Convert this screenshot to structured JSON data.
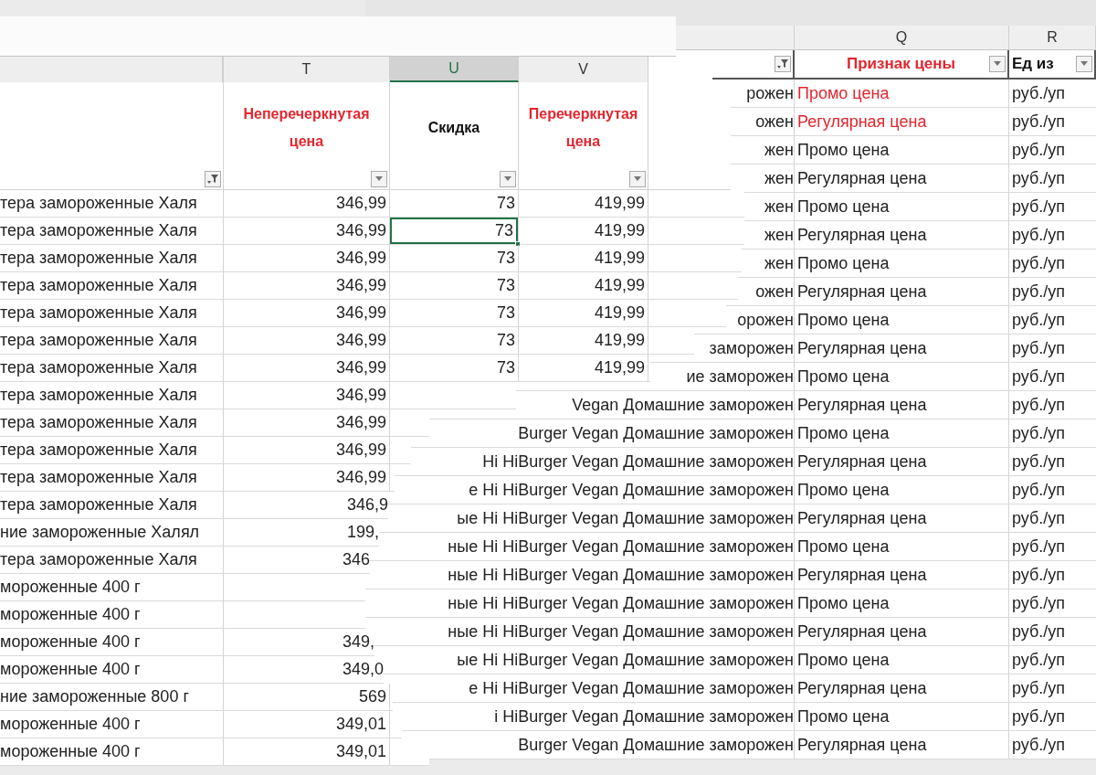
{
  "left_sheet": {
    "first_column": {
      "filter_active": true
    },
    "columns": [
      {
        "letter": "T",
        "selected": false,
        "header": "Неперечеркнутая цена",
        "header_red": true,
        "filter_active": false
      },
      {
        "letter": "U",
        "selected": true,
        "header": "Скидка",
        "header_red": false,
        "filter_active": false
      },
      {
        "letter": "V",
        "selected": false,
        "header": "Перечеркнутая цена",
        "header_red": true,
        "filter_active": false
      }
    ],
    "rows": [
      {
        "name": "тера замороженные Халя",
        "cells": [
          {
            "text": "346,99",
            "selected": false
          },
          {
            "text": "73",
            "selected": false
          },
          {
            "text": "419,99",
            "selected": false
          }
        ]
      },
      {
        "name": "тера замороженные Халя",
        "cells": [
          {
            "text": "346,99",
            "selected": false
          },
          {
            "text": "73",
            "selected": true
          },
          {
            "text": "419,99",
            "selected": false
          }
        ]
      },
      {
        "name": "тера замороженные Халя",
        "cells": [
          {
            "text": "346,99",
            "selected": false
          },
          {
            "text": "73",
            "selected": false
          },
          {
            "text": "419,99",
            "selected": false
          }
        ]
      },
      {
        "name": "тера замороженные Халя",
        "cells": [
          {
            "text": "346,99",
            "selected": false
          },
          {
            "text": "73",
            "selected": false
          },
          {
            "text": "419,99",
            "selected": false
          }
        ]
      },
      {
        "name": "тера замороженные Халя",
        "cells": [
          {
            "text": "346,99",
            "selected": false
          },
          {
            "text": "73",
            "selected": false
          },
          {
            "text": "419,99",
            "selected": false
          }
        ]
      },
      {
        "name": "тера замороженные Халя",
        "cells": [
          {
            "text": "346,99",
            "selected": false
          },
          {
            "text": "73",
            "selected": false
          },
          {
            "text": "419,99",
            "selected": false
          }
        ]
      },
      {
        "name": "тера замороженные Халя",
        "cells": [
          {
            "text": "346,99",
            "selected": false
          },
          {
            "text": "73",
            "selected": false
          },
          {
            "text": "419,99",
            "selected": false
          }
        ]
      },
      {
        "name": "тера замороженные Халя",
        "cells": [
          {
            "text": "346,99",
            "selected": false
          }
        ]
      },
      {
        "name": "тера замороженные Халя",
        "cells": [
          {
            "text": "346,99",
            "selected": false
          }
        ]
      },
      {
        "name": "тера замороженные Халя",
        "cells": [
          {
            "text": "346,99",
            "selected": false
          }
        ]
      },
      {
        "name": "тера замороженные Халя",
        "cells": [
          {
            "text": "346,99",
            "selected": false
          }
        ]
      },
      {
        "name": "тера замороженные Халя",
        "cells": [
          {
            "text": "346,9",
            "selected": false
          }
        ]
      },
      {
        "name": "ние замороженные Халял",
        "cells": [
          {
            "text": "199,",
            "selected": false
          }
        ]
      },
      {
        "name": "тера замороженные Халя",
        "cells": [
          {
            "text": "346",
            "selected": false
          }
        ]
      },
      {
        "name": "мороженные 400 г",
        "cells": []
      },
      {
        "name": "мороженные 400 г",
        "cells": []
      },
      {
        "name": "мороженные 400 г",
        "cells": [
          {
            "text": "349,",
            "selected": false
          }
        ]
      },
      {
        "name": "мороженные 400 г",
        "cells": [
          {
            "text": "349,0",
            "selected": false
          }
        ]
      },
      {
        "name": "ние замороженные 800 г",
        "cells": [
          {
            "text": "569",
            "selected": false
          }
        ]
      },
      {
        "name": "мороженные 400 г",
        "cells": [
          {
            "text": "349,01",
            "selected": false
          }
        ]
      },
      {
        "name": "мороженные 400 г",
        "cells": [
          {
            "text": "349,01",
            "selected": false
          }
        ]
      }
    ]
  },
  "right_sheet": {
    "first_column": {
      "filter_active": true
    },
    "columns": [
      {
        "letter": "Q",
        "header": "Признак цены",
        "header_red": true,
        "filter_active": false
      },
      {
        "letter": "R",
        "header": "Ед из",
        "header_red": false,
        "filter_active": false
      }
    ],
    "rows": [
      {
        "name": "рожен",
        "price_type": "Промо цена",
        "price_type_red": true,
        "unit": "руб./уп"
      },
      {
        "name": "ожен",
        "price_type": "Регулярная цена",
        "price_type_red": true,
        "unit": "руб./уп"
      },
      {
        "name": "жен",
        "price_type": "Промо цена",
        "price_type_red": false,
        "unit": "руб./уп"
      },
      {
        "name": "жен",
        "price_type": "Регулярная цена",
        "price_type_red": false,
        "unit": "руб./уп"
      },
      {
        "name": "жен",
        "price_type": "Промо цена",
        "price_type_red": false,
        "unit": "руб./уп"
      },
      {
        "name": "жен",
        "price_type": "Регулярная цена",
        "price_type_red": false,
        "unit": "руб./уп"
      },
      {
        "name": "жен",
        "price_type": "Промо цена",
        "price_type_red": false,
        "unit": "руб./уп"
      },
      {
        "name": "ожен",
        "price_type": "Регулярная цена",
        "price_type_red": false,
        "unit": "руб./уп"
      },
      {
        "name": "орожен",
        "price_type": "Промо цена",
        "price_type_red": false,
        "unit": "руб./уп"
      },
      {
        "name": "заморожен",
        "price_type": "Регулярная цена",
        "price_type_red": false,
        "unit": "руб./уп"
      },
      {
        "name": "ие заморожен",
        "price_type": "Промо цена",
        "price_type_red": false,
        "unit": "руб./уп"
      },
      {
        "name": "Vegan Домашние заморожен",
        "price_type": "Регулярная цена",
        "price_type_red": false,
        "unit": "руб./уп"
      },
      {
        "name": "Burger Vegan Домашние заморожен",
        "price_type": "Промо цена",
        "price_type_red": false,
        "unit": "руб./уп"
      },
      {
        "name": "Hi HiBurger Vegan Домашние заморожен",
        "price_type": "Регулярная цена",
        "price_type_red": false,
        "unit": "руб./уп"
      },
      {
        "name": "е Hi HiBurger Vegan Домашние заморожен",
        "price_type": "Промо цена",
        "price_type_red": false,
        "unit": "руб./уп"
      },
      {
        "name": "ые Hi HiBurger Vegan Домашние заморожен",
        "price_type": "Регулярная цена",
        "price_type_red": false,
        "unit": "руб./уп"
      },
      {
        "name": "ные Hi HiBurger Vegan Домашние заморожен",
        "price_type": "Промо цена",
        "price_type_red": false,
        "unit": "руб./уп"
      },
      {
        "name": "ные Hi HiBurger Vegan Домашние заморожен",
        "price_type": "Регулярная цена",
        "price_type_red": false,
        "unit": "руб./уп"
      },
      {
        "name": "ные Hi HiBurger Vegan Домашние заморожен",
        "price_type": "Промо цена",
        "price_type_red": false,
        "unit": "руб./уп"
      },
      {
        "name": "ные Hi HiBurger Vegan Домашние заморожен",
        "price_type": "Регулярная цена",
        "price_type_red": false,
        "unit": "руб./уп"
      },
      {
        "name": "ые Hi HiBurger Vegan Домашние заморожен",
        "price_type": "Промо цена",
        "price_type_red": false,
        "unit": "руб./уп"
      },
      {
        "name": "е Hi HiBurger Vegan Домашние заморожен",
        "price_type": "Регулярная цена",
        "price_type_red": false,
        "unit": "руб./уп"
      },
      {
        "name": "i HiBurger Vegan Домашние заморожен",
        "price_type": "Промо цена",
        "price_type_red": false,
        "unit": "руб./уп"
      },
      {
        "name": "Burger Vegan Домашние заморожен",
        "price_type": "Регулярная цена",
        "price_type_red": false,
        "unit": "руб./уп"
      }
    ]
  }
}
